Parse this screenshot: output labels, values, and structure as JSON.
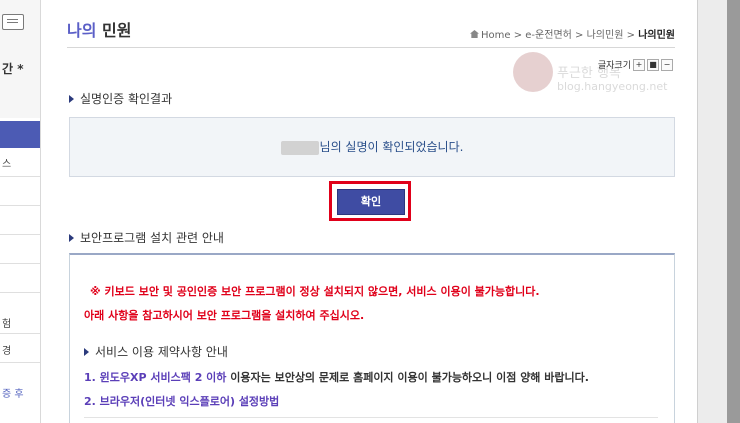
{
  "sidebar": {
    "title": "간 *",
    "items": [
      "스",
      "",
      "",
      "",
      "",
      "험",
      "경"
    ],
    "link": "증 후"
  },
  "header": {
    "title_accent": "나의",
    "title_rest": "민원",
    "breadcrumb": {
      "home": "Home",
      "sep": ">",
      "path1": "e-운전면허",
      "path2": "나의민원",
      "current": "나의민원"
    }
  },
  "font_size": {
    "label": "글자크기",
    "plus": "+",
    "reset": "■",
    "minus": "−"
  },
  "verification": {
    "heading": "실명인증 확인결과",
    "message": "님의 실명이 확인되었습니다.",
    "confirm_label": "확인"
  },
  "security": {
    "heading": "보안프로그램 설치 관련 안내",
    "warning1": "※ 키보드 보안 및 공인인증 보안 프로그램이 정상 설치되지 않으면, 서비스 이용이 불가능합니다.",
    "warning2": "아래 사항을 참고하시어 보안 프로그램을 설치하여 주십시오.",
    "sub_heading": "서비스 이용 제약사항 안내",
    "item1_highlight": "1. 윈도우XP 서비스팩 2 이하",
    "item1_rest": " 이용자는 보안상의 문제로 홈페이지 이용이 불가능하오니 이점 양해 바랍니다.",
    "item2": "2. 브라우저(인터넷 익스플로어) 설정방법"
  },
  "watermark": {
    "text": "푸근한 행복",
    "url": "blog.hangyeong.net"
  }
}
